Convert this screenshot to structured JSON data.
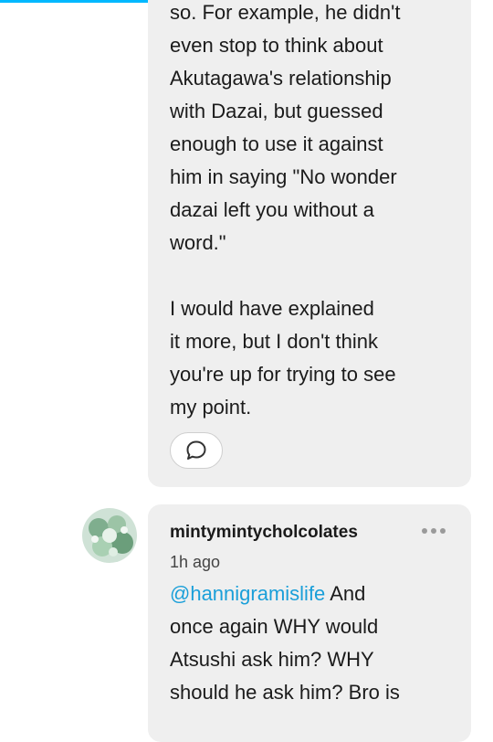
{
  "comment_1": {
    "text": "so. For example, he didn't\neven stop to think about\nAkutagawa's relationship\nwith Dazai, but guessed\nenough to use it against\nhim in saying \"No wonder\ndazai left you without a\nword.\"\n\nI would have explained\nit more, but I don't think\nyou're up for trying to see\nmy point.",
    "reply_icon": "speech-bubble-icon"
  },
  "comment_2": {
    "username": "mintymintycholcolates",
    "timestamp": "1h ago",
    "mention": "@hannigramislife",
    "text": " And\nonce again WHY would\nAtsushi ask him? WHY\nshould he ask him? Bro is",
    "avatar": "avatar",
    "more_icon": "more-dots-icon"
  },
  "colors": {
    "accent": "#00b8ff",
    "mention": "#1a9fd9",
    "bubble": "#efefef"
  }
}
